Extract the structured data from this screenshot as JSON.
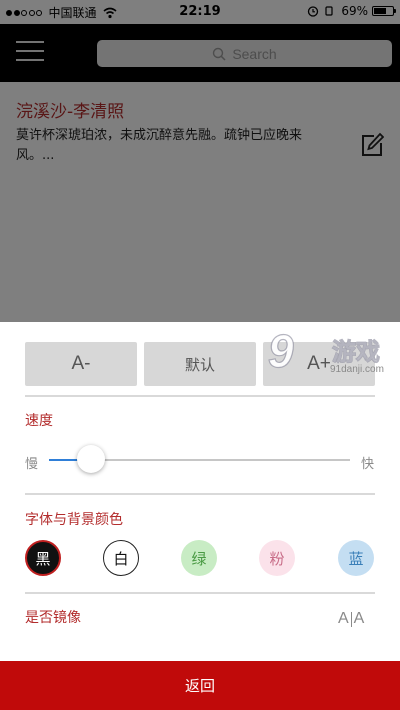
{
  "status_bar": {
    "carrier": "中国联通",
    "time": "22:19",
    "battery_text": "69%",
    "battery_level": 0.69,
    "signal_bars_on": 2,
    "signal_bars_total": 5
  },
  "nav_bar": {
    "menu_icon": "hamburger-menu-icon",
    "search_placeholder": "Search"
  },
  "content": {
    "poem_title": "浣溪沙-李清照",
    "poem_excerpt": "莫许杯深琥珀浓，未成沉醉意先融。疏钟已应晚来风。...",
    "edit_icon": "edit-icon"
  },
  "settings": {
    "font_size_buttons": {
      "decrease": "A-",
      "default": "默认",
      "increase": "A+"
    },
    "speed": {
      "label": "速度",
      "slow": "慢",
      "fast": "快",
      "value": 0.14
    },
    "colors": {
      "label": "字体与背景颜色",
      "options": [
        "黑",
        "白",
        "绿",
        "粉",
        "蓝"
      ],
      "selected": "黑"
    },
    "mirror": {
      "label": "是否镜像",
      "toggle_left": "A",
      "toggle_right": "A"
    },
    "back_label": "返回"
  },
  "watermark": {
    "number": "9",
    "text": "游戏",
    "url": "91danji.com"
  },
  "theme": {
    "accent_red": "#b32d2d",
    "back_button_red": "#c00a0a",
    "slider_blue": "#2f7fd8"
  }
}
